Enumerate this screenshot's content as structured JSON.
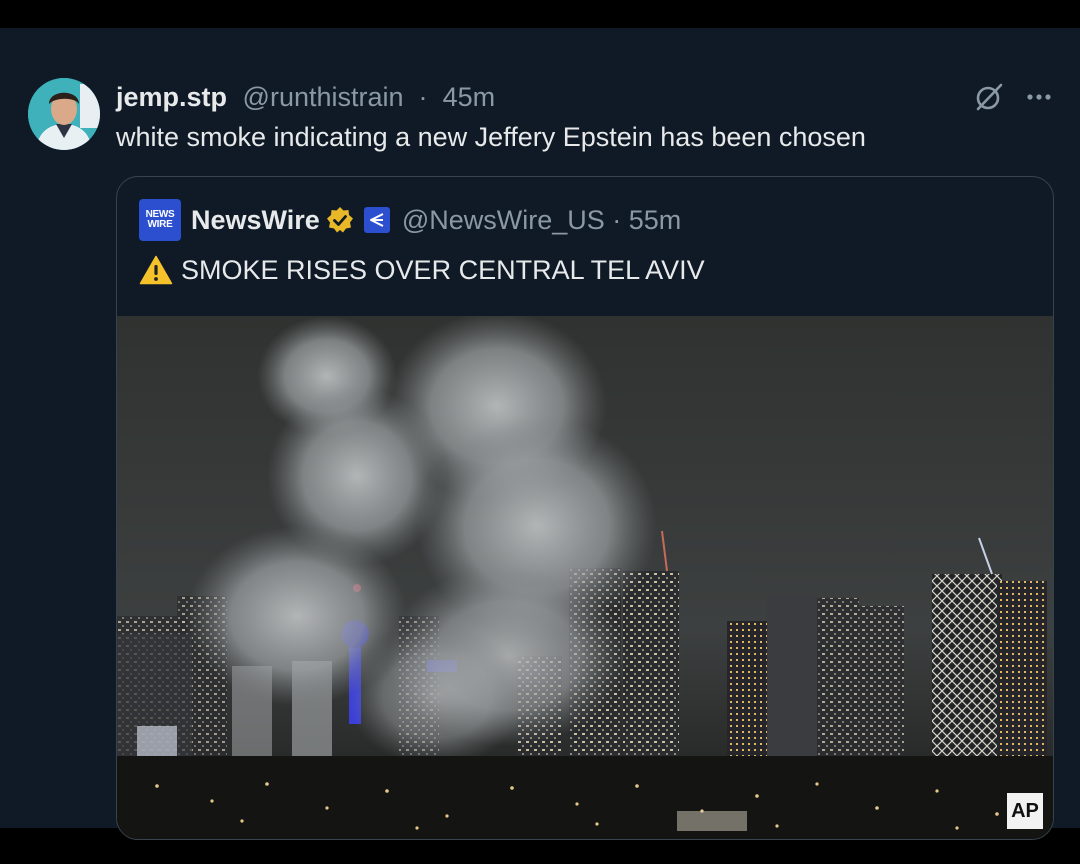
{
  "post": {
    "display_name": "jemp.stp",
    "handle": "@runthistrain",
    "separator": "·",
    "time": "45m",
    "text": "white smoke indicating a new Jeffery Epstein has been chosen",
    "icons": [
      "grok-icon",
      "more-icon"
    ]
  },
  "quote": {
    "logo_line1": "NEWS",
    "logo_line2": "WIRE",
    "display_name": "NewsWire",
    "verified_badge": "gold-check-badge",
    "affiliate_icon": "newswire-affiliate-icon",
    "handle": "@NewsWire_US",
    "separator": "·",
    "time": "55m",
    "warning_icon": "warning-icon",
    "text": "SMOKE RISES OVER CENTRAL TEL AVIV",
    "media_watermark": "AP"
  },
  "colors": {
    "background": "#0f1a26",
    "text_primary": "#e7e9ea",
    "text_secondary": "#8b98a5",
    "border": "#38444d",
    "verified_gold": "#e8b829",
    "brand_blue": "#2b4fcf"
  }
}
